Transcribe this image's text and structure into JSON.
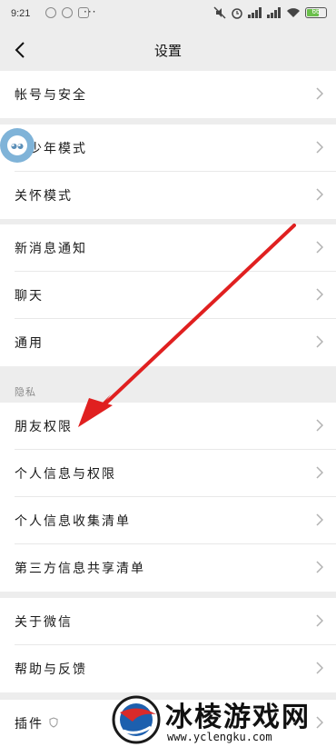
{
  "status_bar": {
    "time": "9:21",
    "more": "···",
    "battery_level": "66"
  },
  "nav": {
    "title": "设置"
  },
  "groups": [
    {
      "items": [
        {
          "label": "帐号与安全"
        }
      ]
    },
    {
      "items": [
        {
          "label": "青少年模式"
        },
        {
          "label": "关怀模式"
        }
      ]
    },
    {
      "items": [
        {
          "label": "新消息通知"
        },
        {
          "label": "聊天"
        },
        {
          "label": "通用"
        }
      ]
    },
    {
      "header": "隐私",
      "items": [
        {
          "label": "朋友权限"
        },
        {
          "label": "个人信息与权限"
        },
        {
          "label": "个人信息收集清单"
        },
        {
          "label": "第三方信息共享清单"
        }
      ]
    },
    {
      "items": [
        {
          "label": "关于微信"
        },
        {
          "label": "帮助与反馈"
        }
      ]
    },
    {
      "items": [
        {
          "label": "插件"
        }
      ]
    }
  ],
  "watermark": {
    "title": "冰棱游戏网",
    "url": "www.yclengku.com"
  },
  "colors": {
    "background": "#ededed",
    "card": "#ffffff",
    "arrow": "#e02020",
    "label": "#191919"
  }
}
